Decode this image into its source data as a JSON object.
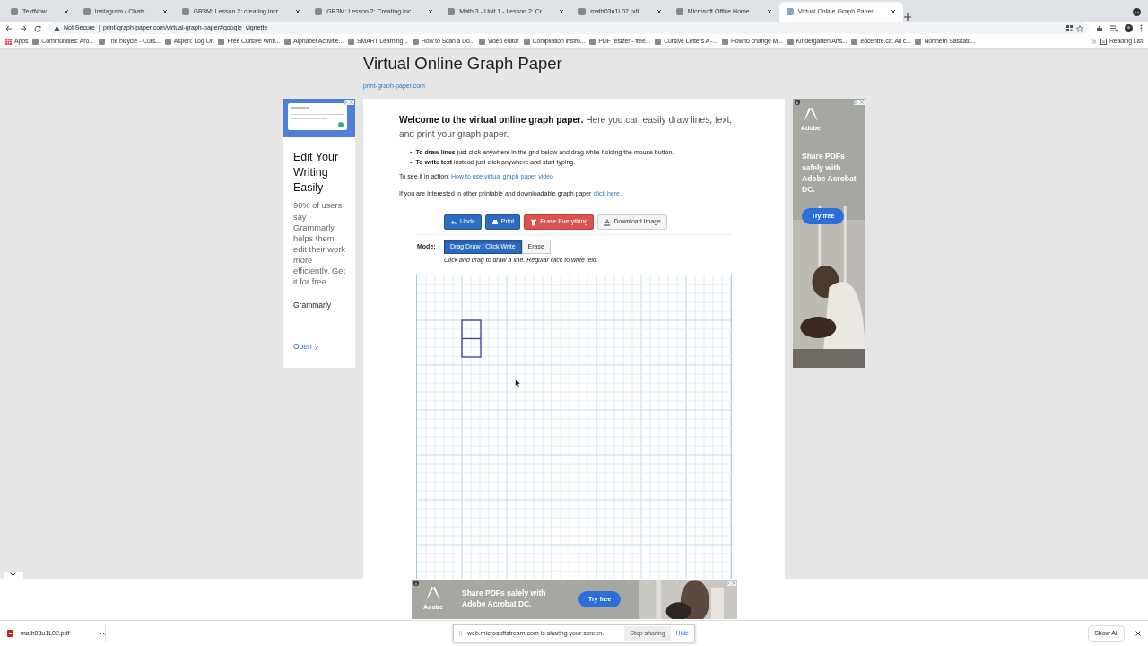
{
  "browser": {
    "tabs": [
      {
        "title": "TextNow",
        "selected": false
      },
      {
        "title": "Instagram • Chats",
        "selected": false
      },
      {
        "title": "GR3M: Lesson 2: creating incr",
        "selected": false
      },
      {
        "title": "GR3M: Lesson 2: Creating Inc",
        "selected": false
      },
      {
        "title": "Math 3 - Unit 1 - Lesson 2: Cr",
        "selected": false
      },
      {
        "title": "math03u1L02.pdf",
        "selected": false
      },
      {
        "title": "Microsoft Office Home",
        "selected": false
      },
      {
        "title": "Virtual Online Graph Paper",
        "selected": true
      }
    ],
    "address": {
      "security": "Not Secure",
      "url": "print-graph-paper.com/virtual-graph-paper#google_vignette"
    },
    "bookmarks": [
      "Apps",
      "Communities: Aro...",
      "The bicycle - Curs...",
      "Aspen: Log On",
      "Free Cursive Writi...",
      "Alphabet Activitie...",
      "SMART Learning...",
      "How to Scan a Do...",
      "video editor",
      "Compilation instru...",
      "PDF resizer - free...",
      "Cursive Letters A -...",
      "How to change M...",
      "Kindergarten Arts...",
      "edcentre.ca: All c...",
      "Northern Saskatc..."
    ],
    "reading_list": "Reading List"
  },
  "page": {
    "title": "Virtual Online Graph Paper",
    "subtitle": "print-graph-paper.com",
    "intro": "**Welcome to the virtual online graph paper.** Here you can easily draw lines, text, and print your graph paper.",
    "bullets": [
      {
        "marker": "•",
        "text": "**To draw lines** just click anywhere in the grid below and drag while holding the mouse button."
      },
      {
        "marker": "•",
        "text": "**To write text** instead just click anywhere and start typing."
      }
    ],
    "demo": {
      "text": "To see it in action:",
      "link": "How to use virtual graph paper video"
    },
    "more": {
      "text": "If you are interested in other printable and downloadable graph paper",
      "link": "click here."
    },
    "buttons": [
      {
        "label": "Undo",
        "kind": "undo"
      },
      {
        "label": "Print",
        "kind": "print"
      },
      {
        "label": "Erase Everything",
        "kind": "erase"
      },
      {
        "label": "Download Image",
        "kind": "download"
      }
    ],
    "mode": {
      "label": "Mode:",
      "options": [
        {
          "label": "Drag Draw / Click Write",
          "selected": true
        },
        {
          "label": "Erase",
          "selected": false
        }
      ],
      "hint": "Click and drag to draw a line. Regular click to write text."
    }
  },
  "ads": {
    "left": {
      "headline": "Edit Your Writing Easily",
      "body": "90% of users say Grammarly helps them edit their work more efficiently. Get it for free.",
      "brand": "Grammarly",
      "cta": "Open"
    },
    "right": {
      "brand": "Adobe",
      "headline": "Share PDFs safely with Adobe Acrobat DC.",
      "cta": "Try free"
    },
    "bottom": {
      "brand": "Adobe",
      "headline": "Share PDFs safely with Adobe Acrobat DC.",
      "cta": "Try free"
    }
  },
  "downloads": {
    "file": "math03u1L02.pdf",
    "show_all": "Show All"
  },
  "sharing": {
    "message": "web.microsoftstream.com is sharing your screen.",
    "stop": "Stop sharing",
    "hide": "Hide"
  }
}
